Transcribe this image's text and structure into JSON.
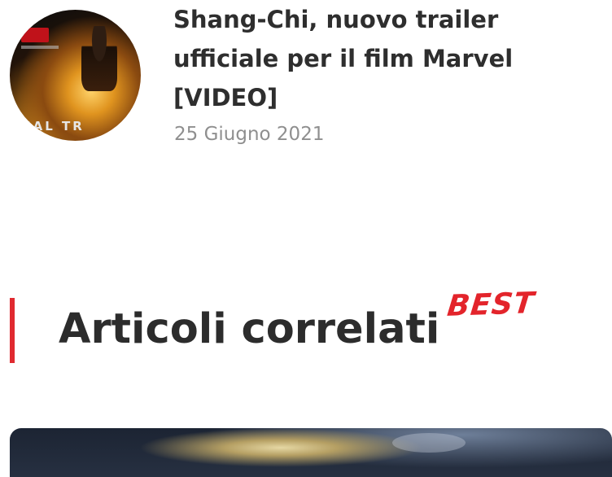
{
  "teaser": {
    "title": "Shang-Chi, nuovo trailer ufficiale per il film Marvel [VIDEO]",
    "date": "25 Giugno 2021",
    "thumbnail_caption": "CIAL TR"
  },
  "section": {
    "title": "Articoli correlati",
    "badge": "BEST",
    "accent_color": "#e02a30"
  },
  "colors": {
    "title_text": "#2e2e2e",
    "date_text": "#8f8f8f",
    "badge_text": "#e3242b"
  }
}
